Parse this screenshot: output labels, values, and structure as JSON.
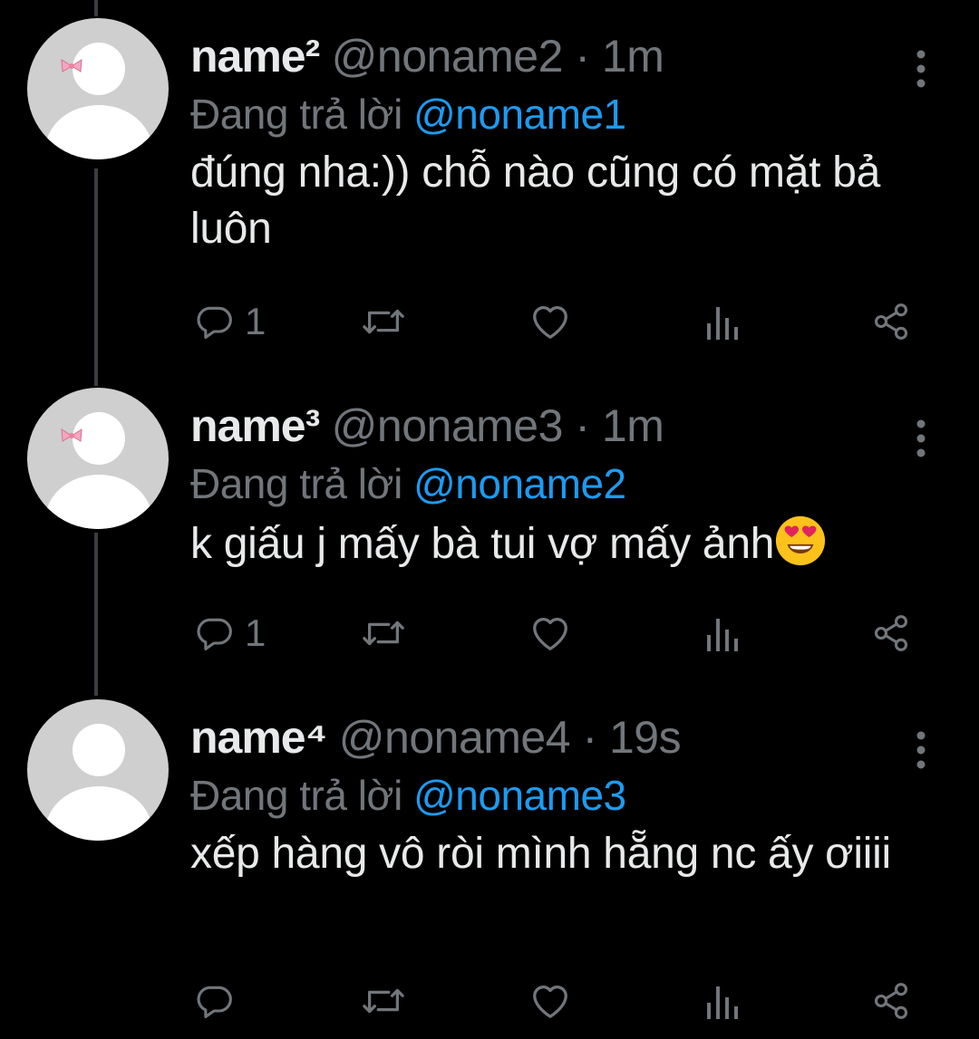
{
  "tweets": [
    {
      "display_name": "name²",
      "handle": "@noname2",
      "separator": "·",
      "time": "1m",
      "reply_prefix": "Đang trả lời",
      "reply_to": "@noname1",
      "text": "đúng nha:)) chỗ nào cũng có mặt bả luôn",
      "reply_count": "1",
      "avatar_icon": "default-avatar-with-pink-bow"
    },
    {
      "display_name": "name³",
      "handle": "@noname3",
      "separator": "·",
      "time": "1m",
      "reply_prefix": "Đang trả lời",
      "reply_to": "@noname2",
      "text": "k giấu j mấy bà tui vợ mấy ảnh",
      "trailing_emoji": "heart-eyes-emoji",
      "reply_count": "1",
      "avatar_icon": "default-avatar-with-pink-bow"
    },
    {
      "display_name": "name⁴",
      "handle": "@noname4",
      "separator": "·",
      "time": "19s",
      "reply_prefix": "Đang trả lời",
      "reply_to": "@noname3",
      "text": "xếp hàng vô ròi mình hẵng nc ấy ơiiii",
      "reply_count": "",
      "avatar_icon": "default-avatar"
    }
  ],
  "colors": {
    "background": "#000000",
    "primary_text": "#e7e9ea",
    "secondary_text": "#71767b",
    "link": "#1d9bf0",
    "thread_line": "#3a3e42",
    "avatar_bg": "#cfcfcf"
  }
}
